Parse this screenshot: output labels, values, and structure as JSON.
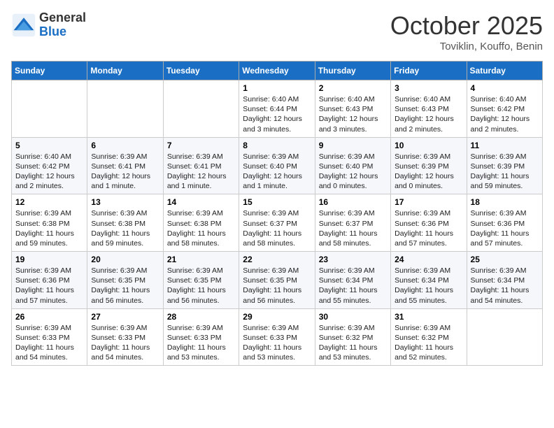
{
  "logo": {
    "general": "General",
    "blue": "Blue"
  },
  "title": "October 2025",
  "location": "Toviklin, Kouffo, Benin",
  "days_of_week": [
    "Sunday",
    "Monday",
    "Tuesday",
    "Wednesday",
    "Thursday",
    "Friday",
    "Saturday"
  ],
  "weeks": [
    [
      {
        "day": "",
        "info": ""
      },
      {
        "day": "",
        "info": ""
      },
      {
        "day": "",
        "info": ""
      },
      {
        "day": "1",
        "info": "Sunrise: 6:40 AM\nSunset: 6:44 PM\nDaylight: 12 hours and 3 minutes."
      },
      {
        "day": "2",
        "info": "Sunrise: 6:40 AM\nSunset: 6:43 PM\nDaylight: 12 hours and 3 minutes."
      },
      {
        "day": "3",
        "info": "Sunrise: 6:40 AM\nSunset: 6:43 PM\nDaylight: 12 hours and 2 minutes."
      },
      {
        "day": "4",
        "info": "Sunrise: 6:40 AM\nSunset: 6:42 PM\nDaylight: 12 hours and 2 minutes."
      }
    ],
    [
      {
        "day": "5",
        "info": "Sunrise: 6:40 AM\nSunset: 6:42 PM\nDaylight: 12 hours and 2 minutes."
      },
      {
        "day": "6",
        "info": "Sunrise: 6:39 AM\nSunset: 6:41 PM\nDaylight: 12 hours and 1 minute."
      },
      {
        "day": "7",
        "info": "Sunrise: 6:39 AM\nSunset: 6:41 PM\nDaylight: 12 hours and 1 minute."
      },
      {
        "day": "8",
        "info": "Sunrise: 6:39 AM\nSunset: 6:40 PM\nDaylight: 12 hours and 1 minute."
      },
      {
        "day": "9",
        "info": "Sunrise: 6:39 AM\nSunset: 6:40 PM\nDaylight: 12 hours and 0 minutes."
      },
      {
        "day": "10",
        "info": "Sunrise: 6:39 AM\nSunset: 6:39 PM\nDaylight: 12 hours and 0 minutes."
      },
      {
        "day": "11",
        "info": "Sunrise: 6:39 AM\nSunset: 6:39 PM\nDaylight: 11 hours and 59 minutes."
      }
    ],
    [
      {
        "day": "12",
        "info": "Sunrise: 6:39 AM\nSunset: 6:38 PM\nDaylight: 11 hours and 59 minutes."
      },
      {
        "day": "13",
        "info": "Sunrise: 6:39 AM\nSunset: 6:38 PM\nDaylight: 11 hours and 59 minutes."
      },
      {
        "day": "14",
        "info": "Sunrise: 6:39 AM\nSunset: 6:38 PM\nDaylight: 11 hours and 58 minutes."
      },
      {
        "day": "15",
        "info": "Sunrise: 6:39 AM\nSunset: 6:37 PM\nDaylight: 11 hours and 58 minutes."
      },
      {
        "day": "16",
        "info": "Sunrise: 6:39 AM\nSunset: 6:37 PM\nDaylight: 11 hours and 58 minutes."
      },
      {
        "day": "17",
        "info": "Sunrise: 6:39 AM\nSunset: 6:36 PM\nDaylight: 11 hours and 57 minutes."
      },
      {
        "day": "18",
        "info": "Sunrise: 6:39 AM\nSunset: 6:36 PM\nDaylight: 11 hours and 57 minutes."
      }
    ],
    [
      {
        "day": "19",
        "info": "Sunrise: 6:39 AM\nSunset: 6:36 PM\nDaylight: 11 hours and 57 minutes."
      },
      {
        "day": "20",
        "info": "Sunrise: 6:39 AM\nSunset: 6:35 PM\nDaylight: 11 hours and 56 minutes."
      },
      {
        "day": "21",
        "info": "Sunrise: 6:39 AM\nSunset: 6:35 PM\nDaylight: 11 hours and 56 minutes."
      },
      {
        "day": "22",
        "info": "Sunrise: 6:39 AM\nSunset: 6:35 PM\nDaylight: 11 hours and 56 minutes."
      },
      {
        "day": "23",
        "info": "Sunrise: 6:39 AM\nSunset: 6:34 PM\nDaylight: 11 hours and 55 minutes."
      },
      {
        "day": "24",
        "info": "Sunrise: 6:39 AM\nSunset: 6:34 PM\nDaylight: 11 hours and 55 minutes."
      },
      {
        "day": "25",
        "info": "Sunrise: 6:39 AM\nSunset: 6:34 PM\nDaylight: 11 hours and 54 minutes."
      }
    ],
    [
      {
        "day": "26",
        "info": "Sunrise: 6:39 AM\nSunset: 6:33 PM\nDaylight: 11 hours and 54 minutes."
      },
      {
        "day": "27",
        "info": "Sunrise: 6:39 AM\nSunset: 6:33 PM\nDaylight: 11 hours and 54 minutes."
      },
      {
        "day": "28",
        "info": "Sunrise: 6:39 AM\nSunset: 6:33 PM\nDaylight: 11 hours and 53 minutes."
      },
      {
        "day": "29",
        "info": "Sunrise: 6:39 AM\nSunset: 6:33 PM\nDaylight: 11 hours and 53 minutes."
      },
      {
        "day": "30",
        "info": "Sunrise: 6:39 AM\nSunset: 6:32 PM\nDaylight: 11 hours and 53 minutes."
      },
      {
        "day": "31",
        "info": "Sunrise: 6:39 AM\nSunset: 6:32 PM\nDaylight: 11 hours and 52 minutes."
      },
      {
        "day": "",
        "info": ""
      }
    ]
  ]
}
